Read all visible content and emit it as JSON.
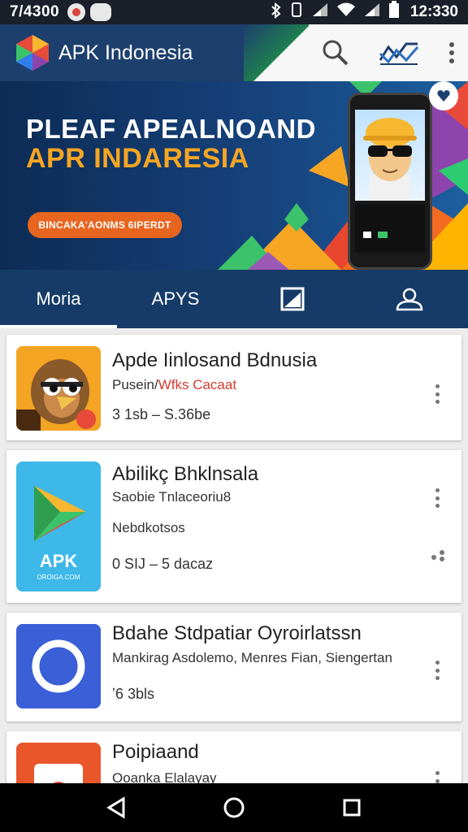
{
  "status_bar": {
    "time": "7/4300",
    "clock": "12:330"
  },
  "app_bar": {
    "title": "APK Indonesia",
    "actions": [
      "search-icon",
      "trend-icon",
      "more-vert-icon"
    ]
  },
  "banner": {
    "line1": "PLEAF APEALNOAND",
    "line2": "APR INDARESIA",
    "cta": "BINCAKA'AONMS 6IPERDT"
  },
  "tabs": [
    {
      "label": "Moria",
      "active": true
    },
    {
      "label": "APYS",
      "active": false
    },
    {
      "label": "",
      "icon": "bookmark-image-icon"
    },
    {
      "label": "",
      "icon": "account-icon"
    }
  ],
  "apps": [
    {
      "title": "Apde Iinlosand Bdnusia",
      "sub_a": "Pusein/",
      "sub_b": "Wfks Cacaat",
      "meta": "3 1sb – S.36be"
    },
    {
      "title": "Abilikç Bhklnsala",
      "sub_a": "Saobie Tnlaceoriu8",
      "meta_line2": "Nebdkotsos",
      "meta": "0 SIJ – 5 dacaz",
      "badge": "APK",
      "badge_sub": "OROIGA.COM"
    },
    {
      "title": "Bdahe Stdpatiar Oyroirlatssn",
      "sub_a": "Mankirag Asdolemo, Menres Fian, Siengertan",
      "meta": "ʼ6 3bls"
    },
    {
      "title": "Poipiaand",
      "sub_a": "Ooanka Elalayay"
    }
  ],
  "colors": {
    "app_bar": "#1d3f6e",
    "tabs_bg": "#163b68",
    "banner_accent": "#f7a623",
    "cta": "#e8651f"
  }
}
